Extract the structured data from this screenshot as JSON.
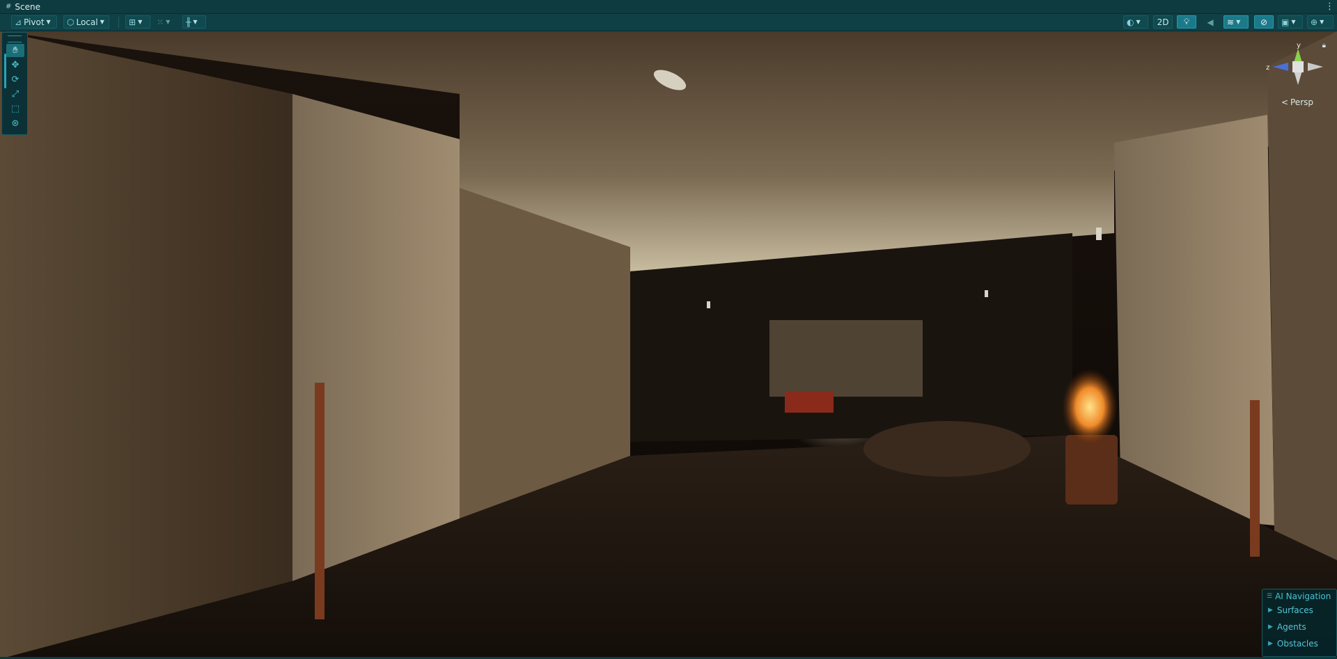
{
  "window": {
    "tab_title": "Scene",
    "menu_glyph": "⋮"
  },
  "toolbar": {
    "pivot_label": "Pivot",
    "space_label": "Local",
    "mode_2d_label": "2D"
  },
  "overlay": {
    "projection_label": "Persp"
  },
  "ai_navigation": {
    "title": "AI Navigation",
    "items": [
      {
        "label": "Surfaces"
      },
      {
        "label": "Agents"
      },
      {
        "label": "Obstacles"
      }
    ]
  },
  "colors": {
    "accent": "#1a7a8a",
    "panel": "#0f4046",
    "ai_text": "#56c6d6"
  },
  "icons": [
    "scene-grid-icon",
    "pivot-icon",
    "local-icon",
    "grid-snap-icon",
    "increment-snap-icon",
    "ruler-icon",
    "shading-mode-icon",
    "lighting-icon",
    "audio-icon",
    "effects-icon",
    "visibility-icon",
    "camera-icon",
    "gizmos-icon",
    "hand-tool-icon",
    "move-tool-icon",
    "rotate-tool-icon",
    "scale-tool-icon",
    "rect-tool-icon",
    "transform-tool-icon"
  ]
}
